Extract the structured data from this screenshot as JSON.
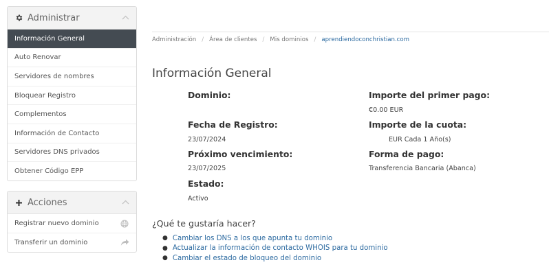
{
  "sidebar": {
    "admin": {
      "title": "Administrar",
      "icon": "gear-icon",
      "items": [
        {
          "label": "Información General",
          "active": true
        },
        {
          "label": "Auto Renovar"
        },
        {
          "label": "Servidores de nombres"
        },
        {
          "label": "Bloquear Registro"
        },
        {
          "label": "Complementos"
        },
        {
          "label": "Información de Contacto"
        },
        {
          "label": "Servidores DNS privados"
        },
        {
          "label": "Obtener Código EPP"
        }
      ]
    },
    "actions": {
      "title": "Acciones",
      "icon": "plus-icon",
      "items": [
        {
          "label": "Registrar nuevo dominio",
          "icon": "globe-icon"
        },
        {
          "label": "Transferir un dominio",
          "icon": "share-arrow-icon"
        }
      ]
    }
  },
  "breadcrumb": [
    "Administración",
    "Área de clientes",
    "Mis dominios",
    "aprendiendoconchristian.com"
  ],
  "page": {
    "title": "Información General",
    "fields": {
      "domain_label": "Dominio:",
      "reg_date_label": "Fecha de Registro:",
      "reg_date": "23/07/2024",
      "next_due_label": "Próximo vencimiento:",
      "next_due": "23/07/2025",
      "status_label": "Estado:",
      "status": "Activo",
      "first_payment_label": "Importe del primer pago:",
      "first_payment": "€0.00 EUR",
      "recurring_label": "Importe de la cuota:",
      "recurring": "EUR Cada 1 Año(s)",
      "payment_method_label": "Forma de pago:",
      "payment_method": "Transferencia Bancaria (Abanca)"
    },
    "what_to_do": "¿Qué te gustaría hacer?",
    "links": [
      "Cambiar los DNS a los que apunta tu dominio",
      "Actualizar la información de contacto WHOIS para tu dominio",
      "Cambiar el estado de bloqueo del dominio"
    ]
  },
  "colors": {
    "active_bg": "#444b52",
    "link": "#2c6aa0"
  }
}
